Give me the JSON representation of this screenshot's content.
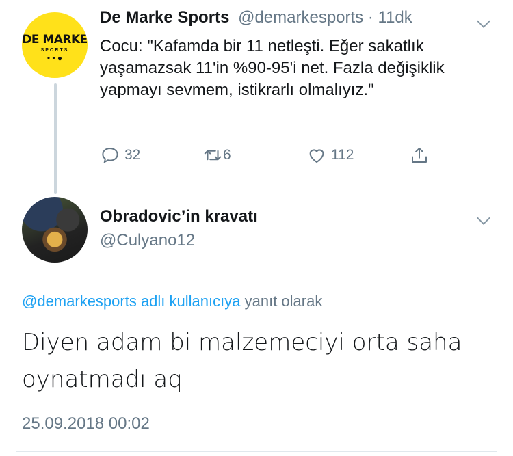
{
  "tweet1": {
    "avatar": {
      "logo_main": "DE MARKE",
      "logo_sub": "SPORTS",
      "logo_dots": "• • ●"
    },
    "author_name": "De Marke Sports",
    "handle": "@demarkesports",
    "separator": "·",
    "time": "11dk",
    "text": "Cocu: \"Kafamda bir 11 netleşti. Eğer sakatlık yaşamazsak 11'in %90-95'i net. Fazla değişiklik yapmayı sevmem, istikrarlı olmalıyız.\"",
    "actions": {
      "reply_count": "32",
      "retweet_count": "6",
      "like_count": "112"
    },
    "icons": [
      "reply-icon",
      "retweet-icon",
      "like-icon",
      "share-icon",
      "chevron-down-icon"
    ]
  },
  "tweet2": {
    "author_name": "Obradovic’in kravatı",
    "handle": "@Culyano12",
    "reply_to_mention": "@demarkesports adlı kullanıcıya",
    "reply_to_suffix": "yanıt olarak",
    "text": "Diyen adam bi malzemeciyi orta saha oynatmadı aq",
    "timestamp": "25.09.2018 00:02"
  },
  "colors": {
    "text": "#14171a",
    "secondary": "#657786",
    "link": "#1da1f2",
    "thread_line": "#ccd6dd",
    "logo_bg": "#ffe11a"
  }
}
